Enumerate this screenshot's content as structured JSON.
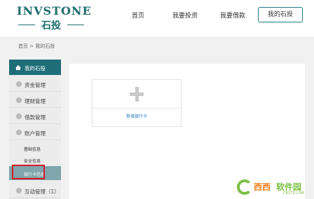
{
  "header": {
    "logo_brand": "INVSTONE",
    "logo_sub": "石投",
    "nav": {
      "home": "首页",
      "invest": "我要投资",
      "borrow": "我要借款",
      "mine": "我的石投"
    }
  },
  "breadcrumb": "首页 > 我的石投",
  "sidebar": {
    "mine": "我的石投",
    "fund": "资金管理",
    "wealth": "理财管理",
    "loan": "借款管理",
    "account": "账户管理",
    "sub_basic": "基础信息",
    "sub_security": "安全信息",
    "sub_bank": "银行卡信息",
    "interact": "互动管理（1）"
  },
  "content": {
    "add_card_label": "新增银行卡"
  },
  "watermark": {
    "text1": "西西",
    "text2": "软件园",
    "text3": "CR173.COM"
  },
  "colors": {
    "accent": "#1e6e78",
    "highlight": "#d8182a",
    "link": "#2a7fbf"
  }
}
